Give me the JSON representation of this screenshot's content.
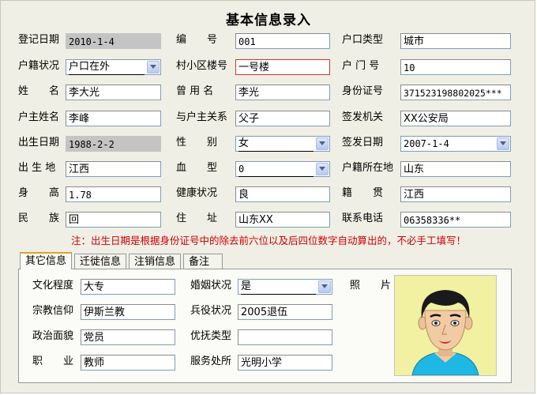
{
  "title": "基本信息录入",
  "labels": {
    "reg_date": "登记日期",
    "number": "编　　号",
    "hukou_type": "户口类型",
    "hukou_status": "户籍状况",
    "building": "村小区楼号",
    "door": "户 门 号",
    "name": "姓　　名",
    "former_name": "曾 用 名",
    "id_no": "身份证号",
    "householder": "户主姓名",
    "relation": "与户主关系",
    "issuer": "签发机关",
    "birth_date": "出生日期",
    "gender": "性　　别",
    "issue_date": "签发日期",
    "birthplace": "出 生 地",
    "blood_type": "血　　型",
    "hukou_place": "户籍所在地",
    "height": "身　　高",
    "health": "健康状况",
    "native_place": "籍　　贯",
    "ethnicity": "民　　族",
    "address": "住　　址",
    "phone": "联系电话"
  },
  "values": {
    "reg_date": "2010-1-4",
    "number": "001",
    "hukou_type": "城市",
    "hukou_status": "户口在外",
    "building": "一号楼",
    "door": "10",
    "name": "李大光",
    "former_name": "李光",
    "id_no": "371523198802025***",
    "householder": "李峰",
    "relation": "父子",
    "issuer": "XX公安局",
    "birth_date": "1988-2-2",
    "gender": "女",
    "issue_date": "2007-1-4",
    "birthplace": "江西",
    "blood_type": "0",
    "hukou_place": "山东",
    "height": "1.78",
    "health": "良",
    "native_place": "江西",
    "ethnicity": "回",
    "address": "山东XX",
    "phone": "06358336**"
  },
  "note": "注：出生日期是根据身份证号中的除去前六位以及后四位数字自动算出的，不必手工填写！",
  "tabs": [
    "其它信息",
    "迁徙信息",
    "注销信息",
    "备注"
  ],
  "other": {
    "labels": {
      "education": "文化程度",
      "marriage": "婚姻状况",
      "religion": "宗教信仰",
      "military": "兵役状况",
      "politics": "政治面貌",
      "care_type": "优抚类型",
      "job": "职　　业",
      "service_place": "服务处所",
      "photo": "照　　片"
    },
    "values": {
      "education": "大专",
      "marriage": "是",
      "religion": "伊斯兰教",
      "military": "2005退伍",
      "politics": "党员",
      "care_type": "",
      "job": "教师",
      "service_place": "光明小学"
    }
  },
  "colors": {
    "window_bg": "#f0efe6",
    "readonly_field": "#c4c4c4",
    "note_text": "#cc0000",
    "focused_border": "#cc3333",
    "photo_bg": "#f1f1a1"
  }
}
